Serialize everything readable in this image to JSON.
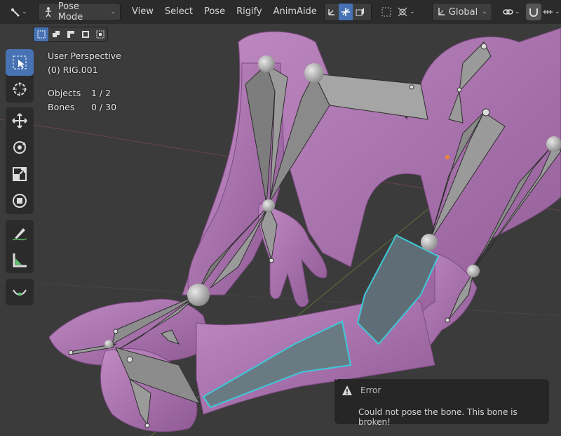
{
  "header": {
    "mode_label": "Pose Mode",
    "menus": [
      "View",
      "Select",
      "Pose",
      "Rigify",
      "AnimAide"
    ],
    "transform_orientation": "Global"
  },
  "overlay": {
    "view_name": "User Perspective",
    "object_name": "(0) RIG.001",
    "objects_label": "Objects",
    "objects_value": "1 / 2",
    "bones_label": "Bones",
    "bones_value": "0 / 30"
  },
  "notification": {
    "title": "Error",
    "message": "Could not pose the bone. This bone is broken!"
  },
  "colors": {
    "accent": "#4772b3",
    "mesh": "#b27ab5",
    "bone": "#8f8f8f",
    "selected_outline": "#3fc8d8"
  }
}
